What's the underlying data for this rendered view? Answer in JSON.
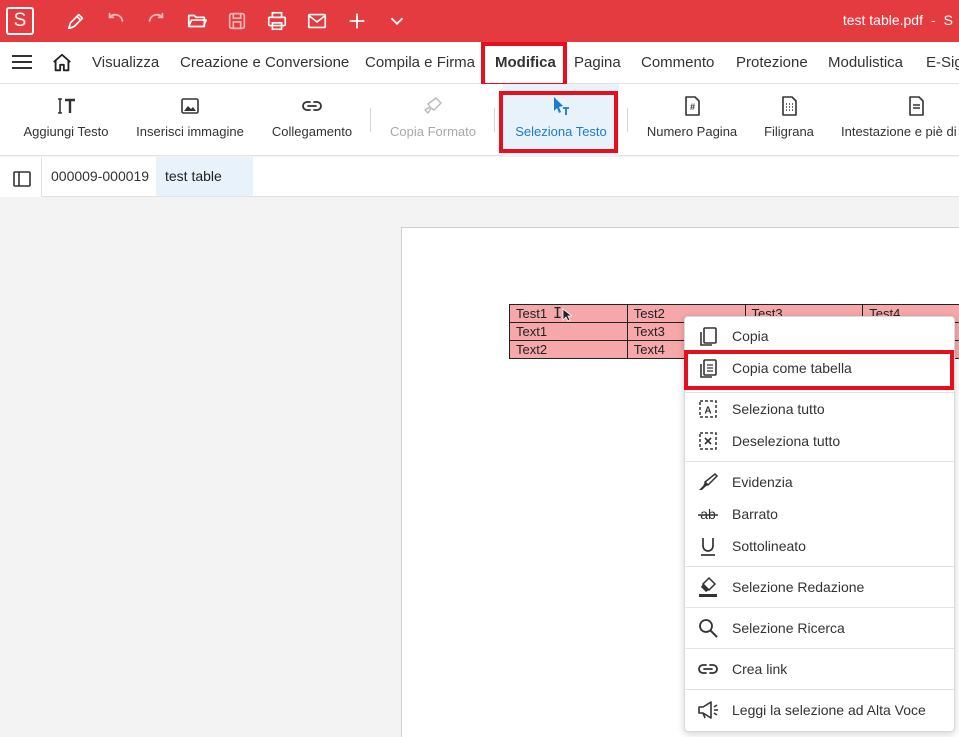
{
  "app": {
    "logo_letter": "S",
    "brand_color": "#e33b3f",
    "highlight_color": "#e5101f",
    "document_title": "test table.pdf",
    "title_separator": "-",
    "title_trailing": "S"
  },
  "quick_access": [
    "pen-icon",
    "undo-icon",
    "redo-icon",
    "open-folder-icon",
    "save-icon",
    "print-icon",
    "mail-icon",
    "plus-icon",
    "chevron-down-icon"
  ],
  "menu": {
    "tabs": [
      "Visualizza",
      "Creazione e Conversione",
      "Compila e Firma",
      "Modifica",
      "Pagina",
      "Commento",
      "Protezione",
      "Modulistica",
      "E-Sig"
    ],
    "active": "Modifica"
  },
  "ribbon": {
    "items": [
      {
        "label": "Aggiungi Testo",
        "icon": "add-text-icon"
      },
      {
        "label": "Inserisci immagine",
        "icon": "image-icon"
      },
      {
        "label": "Collegamento",
        "icon": "link-icon"
      },
      {
        "label": "Copia Formato",
        "icon": "format-painter-icon",
        "disabled": true
      },
      {
        "label": "Seleziona Testo",
        "icon": "select-text-icon",
        "selected": true
      },
      {
        "label": "Numero Pagina",
        "icon": "page-number-icon"
      },
      {
        "label": "Filigrana",
        "icon": "watermark-icon"
      },
      {
        "label": "Intestazione e piè di p",
        "icon": "header-footer-icon"
      }
    ]
  },
  "file_tabs": [
    {
      "label": "000009-000019"
    },
    {
      "label": "test table",
      "active": true
    }
  ],
  "pdf_table": {
    "rows": [
      [
        "Test1",
        "Test2",
        "Test3",
        "Test4"
      ],
      [
        "Text1",
        "Text3",
        "",
        ""
      ],
      [
        "Text2",
        "Text4",
        "",
        ""
      ]
    ],
    "selection_color": "#f5a7a9"
  },
  "context_menu": {
    "items": [
      {
        "label": "Copia",
        "icon": "copy-icon"
      },
      {
        "label": "Copia come tabella",
        "icon": "copy-table-icon",
        "highlighted": true
      },
      {
        "label": "Seleziona tutto",
        "icon": "select-all-icon"
      },
      {
        "label": "Deseleziona tutto",
        "icon": "deselect-all-icon"
      },
      {
        "label": "Evidenzia",
        "icon": "highlight-icon"
      },
      {
        "label": "Barrato",
        "icon": "strikethrough-icon"
      },
      {
        "label": "Sottolineato",
        "icon": "underline-icon"
      },
      {
        "label": "Selezione Redazione",
        "icon": "redaction-icon"
      },
      {
        "label": "Selezione Ricerca",
        "icon": "search-icon"
      },
      {
        "label": "Crea link",
        "icon": "create-link-icon"
      },
      {
        "label": "Leggi la selezione ad Alta Voce",
        "icon": "read-aloud-icon"
      }
    ]
  }
}
